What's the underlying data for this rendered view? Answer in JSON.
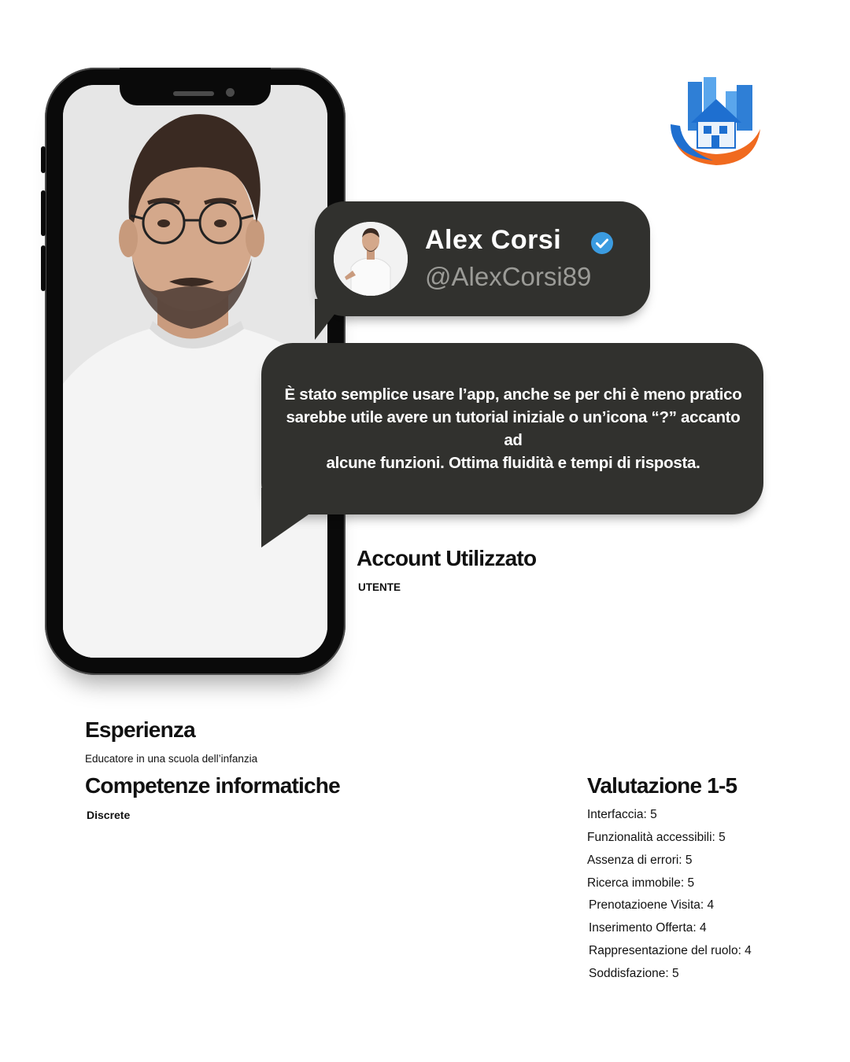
{
  "profile": {
    "name": "Alex Corsi",
    "handle": "@AlexCorsi89",
    "verified_icon": "verified-badge-icon"
  },
  "review": {
    "line1": "È stato semplice usare l’app, anche se per chi è meno pratico",
    "line2": "sarebbe utile avere un tutorial iniziale o un’icona “?” accanto ad",
    "line3": "alcune funzioni. Ottima fluidità e tempi di risposta."
  },
  "account": {
    "heading": "Account Utilizzato",
    "value": "UTENTE"
  },
  "experience": {
    "heading": "Esperienza",
    "value": "Educatore in una scuola dell’infanzia"
  },
  "skills": {
    "heading": "Competenze informatiche",
    "value": "Discrete"
  },
  "rating": {
    "heading": "Valutazione 1-5",
    "items": [
      "Interfaccia: 5",
      "Funzionalità accessibili: 5",
      "Assenza di errori: 5",
      "Ricerca immobile: 5",
      "Prenotazioene Visita: 4",
      "Inserimento Offerta: 4",
      "Rappresentazione del ruolo: 4",
      "Soddisfazione: 5"
    ]
  },
  "colors": {
    "bubble": "#31312e",
    "handle": "#9b9b97",
    "verified": "#3b9be0",
    "logo_blue": "#1e6fd0",
    "logo_orange": "#f06a1f"
  }
}
